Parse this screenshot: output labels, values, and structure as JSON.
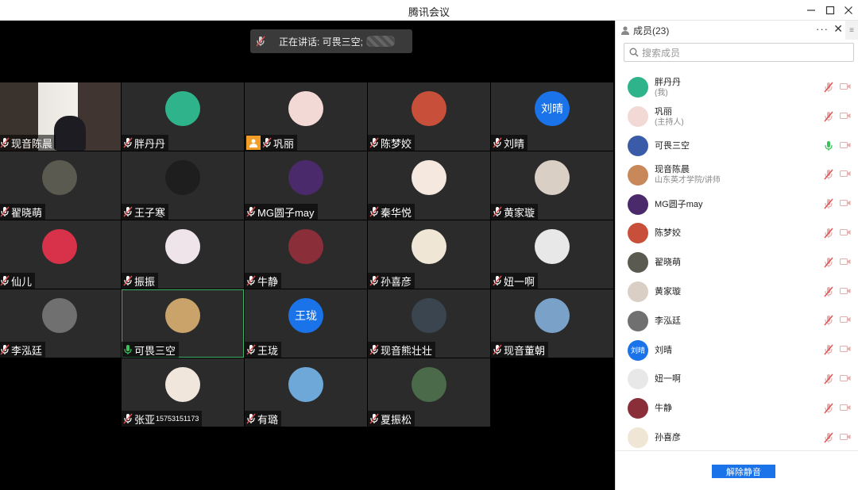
{
  "window": {
    "title": "腾讯会议",
    "controls": [
      "minimize-icon",
      "maximize-icon",
      "close-icon"
    ]
  },
  "speaking_bar": {
    "label": "正在讲话: 可畏三空;"
  },
  "tiles": [
    {
      "name": "现音陈晨",
      "avatar_kind": "video",
      "mic": "muted"
    },
    {
      "name": "胖丹丹",
      "avatar_color": "#2fb38a",
      "mic": "muted"
    },
    {
      "name": "巩丽",
      "avatar_color": "#f2d9d6",
      "mic": "muted",
      "host": true
    },
    {
      "name": "陈梦姣",
      "avatar_color": "#c8503a",
      "mic": "muted"
    },
    {
      "name": "刘晴",
      "avatar_color": "#1a73e8",
      "avatar_text": "刘晴",
      "mic": "muted"
    },
    {
      "name": "翟晓萌",
      "avatar_color": "#5a5a50",
      "mic": "muted"
    },
    {
      "name": "王子寒",
      "avatar_color": "#1e1e1e",
      "mic": "muted"
    },
    {
      "name": "MG圆子may",
      "avatar_color": "#4a2a6a",
      "mic": "muted"
    },
    {
      "name": "秦华悦",
      "avatar_color": "#f4e8df",
      "mic": "muted"
    },
    {
      "name": "黄家璇",
      "avatar_color": "#d9cfc4",
      "mic": "muted"
    },
    {
      "name": "仙儿",
      "avatar_color": "#d8324a",
      "mic": "muted"
    },
    {
      "name": "振振",
      "avatar_color": "#efe4ea",
      "mic": "muted"
    },
    {
      "name": "牛静",
      "avatar_color": "#8a2e3a",
      "mic": "muted"
    },
    {
      "name": "孙喜彦",
      "avatar_color": "#efe6d6",
      "mic": "muted"
    },
    {
      "name": "妞一啊",
      "avatar_color": "#e8e8e8",
      "mic": "muted"
    },
    {
      "name": "李泓廷",
      "avatar_color": "#707070",
      "mic": "muted"
    },
    {
      "name": "可畏三空",
      "avatar_color": "#c9a36a",
      "mic": "on",
      "active": true
    },
    {
      "name": "王珑",
      "avatar_color": "#1a73e8",
      "avatar_text": "王珑",
      "mic": "muted"
    },
    {
      "name": "现音熊壮壮",
      "avatar_color": "#3a4550",
      "mic": "muted"
    },
    {
      "name": "现音董朝",
      "avatar_color": "#7aa2c8",
      "mic": "muted"
    },
    {
      "name": "张亚",
      "name_suffix": "15753151173",
      "avatar_color": "#f0e6dc",
      "mic": "muted"
    },
    {
      "name": "有璐",
      "avatar_color": "#6da8d8",
      "mic": "muted"
    },
    {
      "name": "夏振松",
      "avatar_color": "#4a6a4a",
      "mic": "muted"
    }
  ],
  "members_panel": {
    "title": "成员(23)",
    "more_label": "···",
    "close_label": "✕",
    "side_label": "≡",
    "search_placeholder": "搜索成员",
    "members": [
      {
        "name": "胖丹丹",
        "role": "(我)",
        "avatar_color": "#2fb38a",
        "mic": "muted"
      },
      {
        "name": "巩丽",
        "role": "(主持人)",
        "avatar_color": "#f2d9d6",
        "mic": "muted"
      },
      {
        "name": "可畏三空",
        "role": "",
        "avatar_color": "#3a5ca8",
        "mic": "on"
      },
      {
        "name": "现音陈晨",
        "role": "山东英才学院/讲师",
        "avatar_color": "#c8885a",
        "mic": "muted"
      },
      {
        "name": "MG圆子may",
        "role": "",
        "avatar_color": "#4a2a6a",
        "mic": "muted"
      },
      {
        "name": "陈梦姣",
        "role": "",
        "avatar_color": "#c8503a",
        "mic": "muted"
      },
      {
        "name": "翟晓萌",
        "role": "",
        "avatar_color": "#5a5a50",
        "mic": "muted"
      },
      {
        "name": "黄家璇",
        "role": "",
        "avatar_color": "#d9cfc4",
        "mic": "muted"
      },
      {
        "name": "李泓廷",
        "role": "",
        "avatar_color": "#707070",
        "mic": "muted"
      },
      {
        "name": "刘晴",
        "role": "",
        "avatar_color": "#1a73e8",
        "avatar_text": "刘晴",
        "mic": "muted"
      },
      {
        "name": "妞一啊",
        "role": "",
        "avatar_color": "#e8e8e8",
        "mic": "muted"
      },
      {
        "name": "牛静",
        "role": "",
        "avatar_color": "#8a2e3a",
        "mic": "muted"
      },
      {
        "name": "孙喜彦",
        "role": "",
        "avatar_color": "#efe6d6",
        "mic": "muted"
      }
    ],
    "unmute_all_label": "解除静音"
  },
  "colors": {
    "accent": "#1a73e8",
    "mic_on": "#3cc25a",
    "mic_muted": "#e0a0a0",
    "cam_off": "#e3b0b0",
    "active_border": "#3fb56a",
    "host_badge": "#f39c27"
  }
}
